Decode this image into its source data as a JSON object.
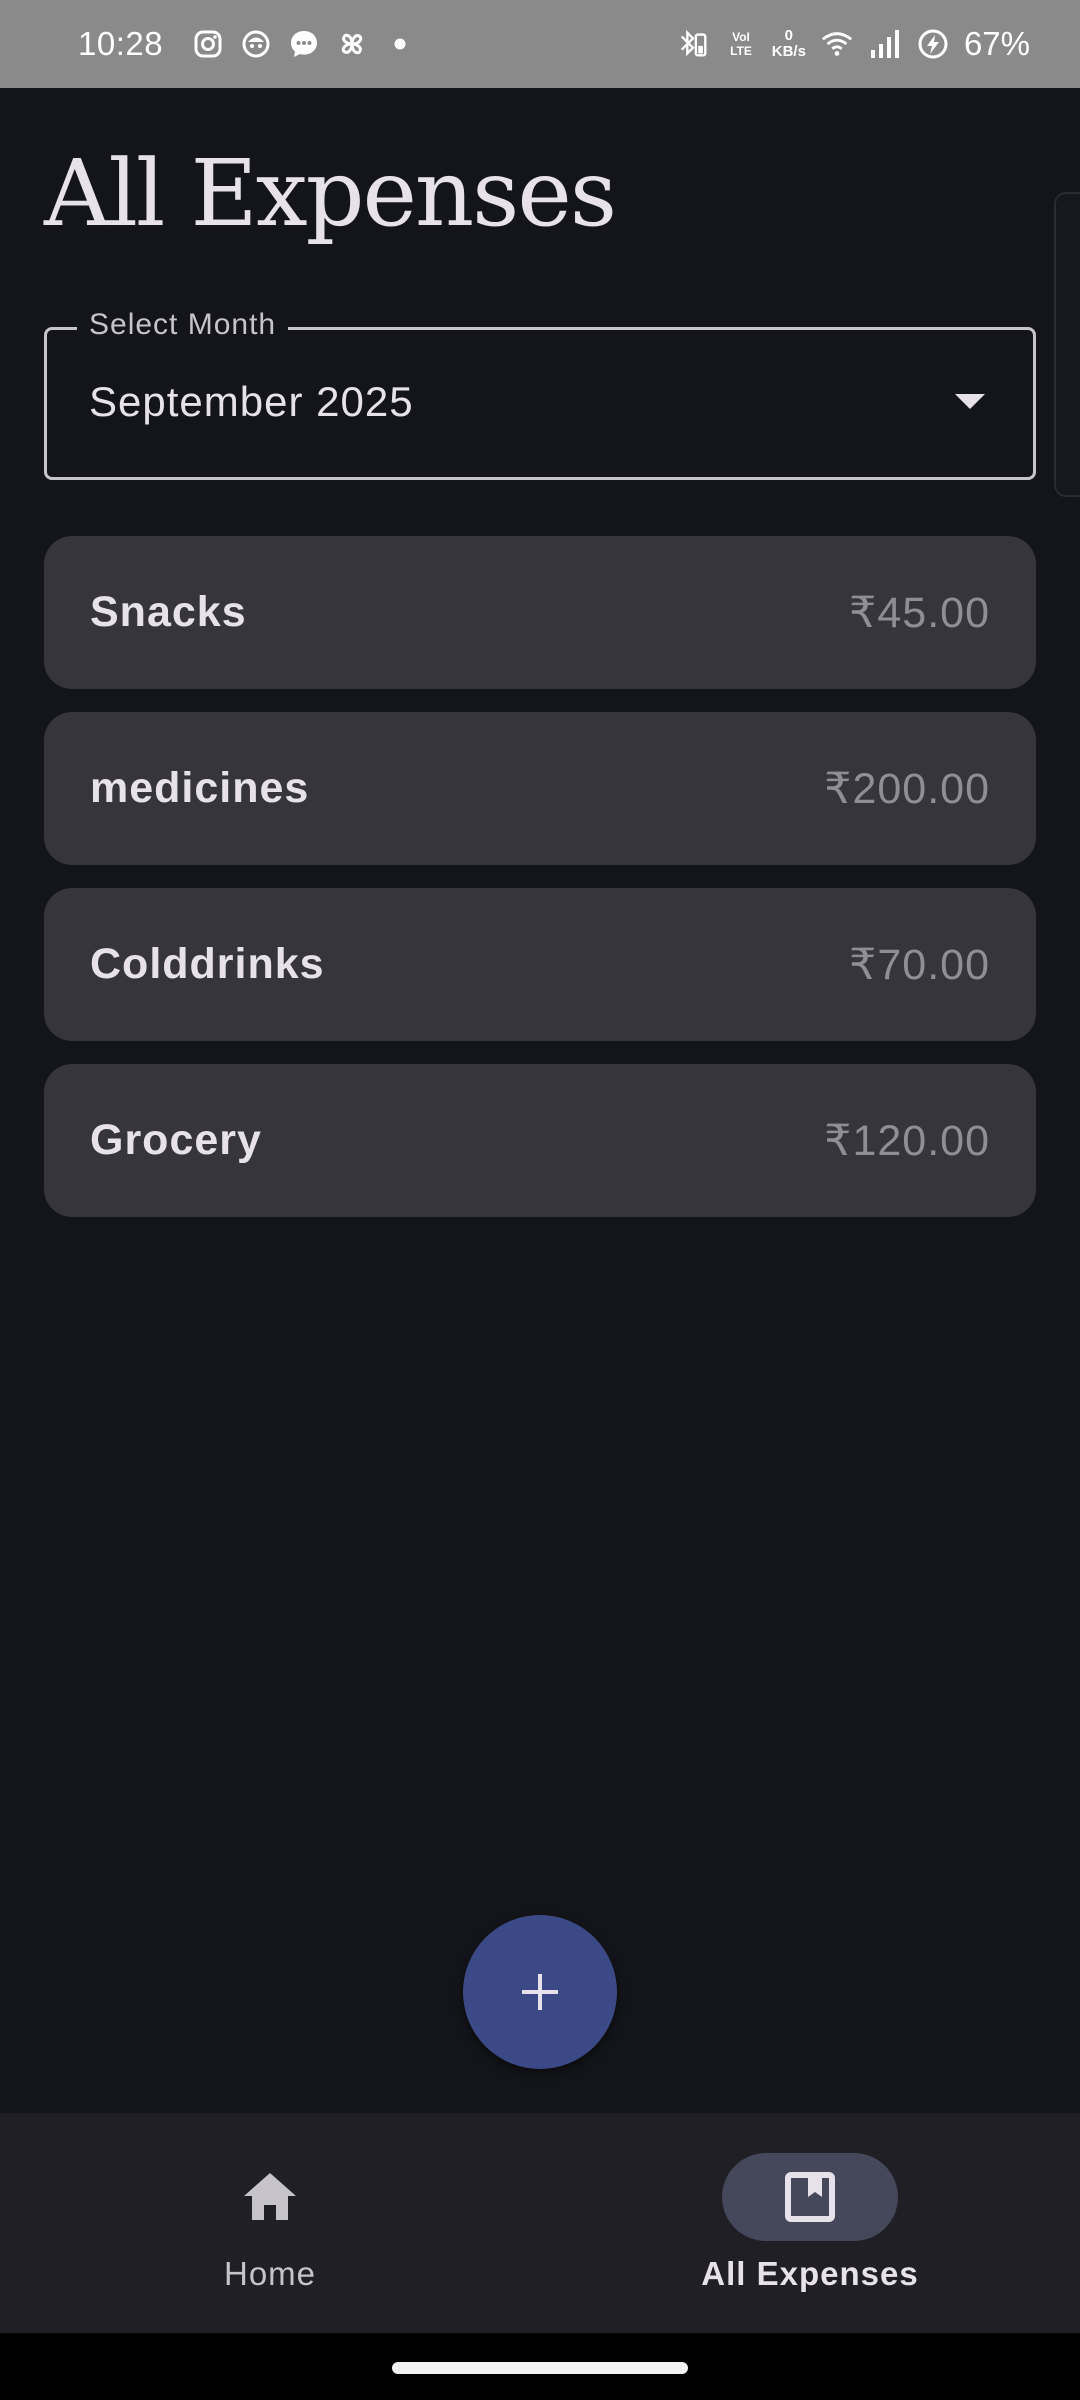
{
  "status_bar": {
    "time": "10:28",
    "left_icons": [
      "instagram-icon",
      "app-icon",
      "chat-icon",
      "pinwheel-icon",
      "dot-icon"
    ],
    "right_icons": [
      "bluetooth-icon",
      "volte-icon",
      "wifi-icon",
      "signal-icon",
      "battery-saver-icon"
    ],
    "speed_value": "0",
    "speed_unit": "KB/s",
    "battery": "67%"
  },
  "page": {
    "title": "All Expenses"
  },
  "month_select": {
    "label": "Select Month",
    "value": "September 2025"
  },
  "expenses": [
    {
      "name": "Snacks",
      "amount": "₹45.00"
    },
    {
      "name": "medicines",
      "amount": "₹200.00"
    },
    {
      "name": "Colddrinks",
      "amount": "₹70.00"
    },
    {
      "name": "Grocery",
      "amount": "₹120.00"
    }
  ],
  "fab": {
    "icon": "plus-icon"
  },
  "bottom_nav": {
    "items": [
      {
        "label": "Home",
        "icon": "home-icon",
        "selected": false
      },
      {
        "label": "All Expenses",
        "icon": "book-icon",
        "selected": true
      }
    ]
  },
  "colors": {
    "background": "#14151a",
    "card": "#36353c",
    "fab": "#3b4a86",
    "nav_background": "#1f1f25",
    "nav_selected_pill": "#45475a",
    "status_bar": "#8a8a8a"
  }
}
